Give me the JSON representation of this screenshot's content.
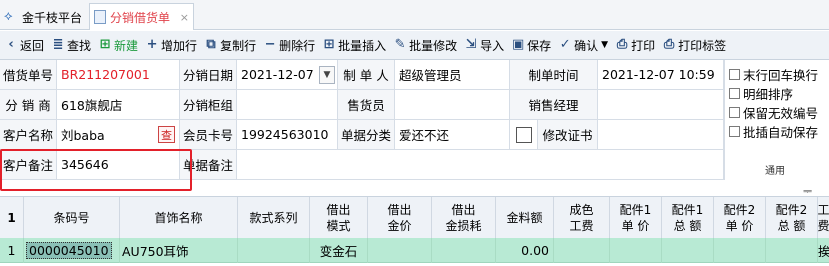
{
  "titlebar": {
    "app_name": "金千枝平台",
    "doc_tab": "分销借货单",
    "close": "×"
  },
  "toolbar": {
    "back": "返回",
    "find": "查找",
    "new": "新建",
    "add_row": "增加行",
    "copy_row": "复制行",
    "delete_row": "删除行",
    "batch_insert": "批量插入",
    "batch_edit": "批量修改",
    "import": "导入",
    "save": "保存",
    "confirm": "确认",
    "print": "打印",
    "print_label": "打印标签"
  },
  "form": {
    "doc_no_label": "借货单号",
    "doc_no": "BR211207001",
    "dist_date_label": "分销日期",
    "dist_date": "2021-12-07",
    "maker_label": "制 单 人",
    "maker": "超级管理员",
    "make_time_label": "制单时间",
    "make_time": "2021-12-07 10:59",
    "dist_shop_label": "分 销 商",
    "dist_shop": "618旗舰店",
    "dist_counter_label": "分销柜组",
    "dist_counter": "",
    "salesperson_label": "售货员",
    "salesperson": "",
    "sales_manager_label": "销售经理",
    "sales_manager": "",
    "customer_label": "客户名称",
    "customer": "刘baba",
    "query": "查",
    "member_card_label": "会员卡号",
    "member_card": "19924563010",
    "doc_class_label": "单据分类",
    "doc_class": "爱还不还",
    "edit_cert_label": "修改证书",
    "customer_remark_label": "客户备注",
    "customer_remark": "345646",
    "doc_remark_label": "单据备注",
    "doc_remark": ""
  },
  "options": {
    "items": [
      "末行回车换行",
      "明细排序",
      "保留无效编号",
      "批插自动保存"
    ],
    "group_label": "通用"
  },
  "grid": {
    "headers": [
      "条码号",
      "首饰名称",
      "款式系列",
      "借出\n模式",
      "借出\n金价",
      "借出\n金损耗",
      "金料额",
      "成色\n工费",
      "配件1\n单 价",
      "配件1\n总 额",
      "配件2\n单 价",
      "配件2\n总 额",
      "工\n费"
    ],
    "row_no_header": "1",
    "rows": [
      {
        "no": "1",
        "barcode": "0000045010",
        "name": "AU750耳饰",
        "series": "",
        "mode": "变金石",
        "gold_price": "",
        "gold_loss": "",
        "gold_amount": "0.00",
        "extra": "挨"
      }
    ]
  }
}
